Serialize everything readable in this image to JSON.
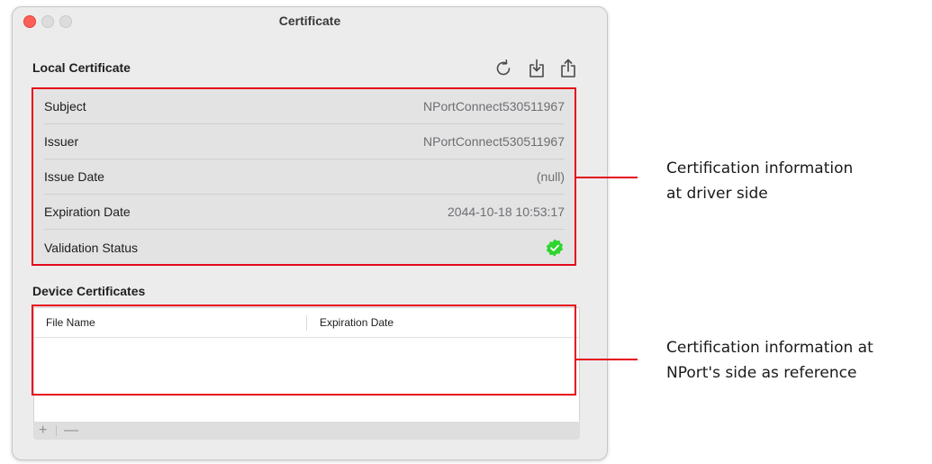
{
  "window": {
    "title": "Certificate"
  },
  "local_certificate": {
    "title": "Local Certificate",
    "toolbar": {
      "refresh_icon": "refresh-icon",
      "download_icon": "download-icon",
      "share_icon": "share-icon"
    },
    "rows": [
      {
        "label": "Subject",
        "value": "NPortConnect530511967"
      },
      {
        "label": "Issuer",
        "value": "NPortConnect530511967"
      },
      {
        "label": "Issue Date",
        "value": "(null)"
      },
      {
        "label": "Expiration Date",
        "value": "2044-10-18 10:53:17"
      },
      {
        "label": "Validation Status",
        "value": "",
        "status_icon": "verified-check-icon",
        "status_color": "#2ed52e"
      }
    ]
  },
  "device_certificates": {
    "title": "Device Certificates",
    "columns": [
      "File Name",
      "Expiration Date"
    ],
    "rows": [],
    "add_label": "+",
    "remove_label": "—"
  },
  "annotations": {
    "driver_side": [
      "Certification information",
      "at driver side"
    ],
    "nport_side": [
      "Certification information at",
      "NPort's side as reference"
    ],
    "highlight_color": "#e5091a"
  }
}
